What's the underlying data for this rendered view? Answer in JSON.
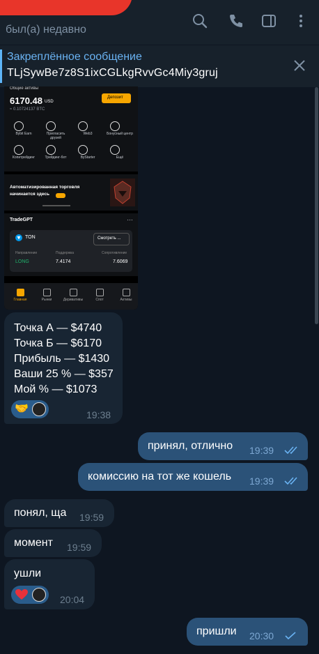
{
  "header": {
    "status": "был(а) недавно"
  },
  "pinned": {
    "title": "Закреплённое сообщение",
    "text": "TLjSywBe7z8S1ixCGLkgRvvGc4Miy3gruj"
  },
  "screenshot": {
    "total_label": "Общие активы",
    "balance": "6170.48",
    "currency": "USD",
    "btc": "≈ 0.10724137 BTC",
    "deposit": "Депозит",
    "icons": [
      "Bybit Earn",
      "Пригласить друзей",
      "Web3",
      "Бонусный центр",
      "Копитрейдинг",
      "Трейдинг-бот",
      "ByStarter",
      "Ещё"
    ],
    "promo": "Автоматизированная торговля начинается здесь",
    "tradegpt": "TradeGPT",
    "coin": "TON",
    "view": "Смотреть ...",
    "direction_label": "Направление",
    "support_label": "Поддержка",
    "resistance_label": "Сопротивление",
    "direction": "LONG",
    "support": "7.4174",
    "resistance": "7.6069",
    "nav": [
      "Главная",
      "Рынки",
      "Деривативы",
      "Спот",
      "Активы"
    ]
  },
  "messages": [
    {
      "dir": "in",
      "lines": [
        "Точка А — $4740",
        "Точка Б — $6170",
        "Прибыль — $1430",
        "Ваши 25 % — $357",
        "Мой % — $1073"
      ],
      "time": "19:38",
      "reaction": "handshake"
    },
    {
      "dir": "out",
      "text": "принял, отлично",
      "time": "19:39"
    },
    {
      "dir": "out",
      "text": "комиссию на тот же кошель",
      "time": "19:39"
    },
    {
      "dir": "in",
      "text": "понял, ща",
      "time": "19:59"
    },
    {
      "dir": "in",
      "text": "момент",
      "time": "19:59"
    },
    {
      "dir": "in",
      "text": "ушли",
      "time": "20:04",
      "reaction": "heart"
    },
    {
      "dir": "out",
      "text": "пришли",
      "time": "20:30"
    }
  ]
}
